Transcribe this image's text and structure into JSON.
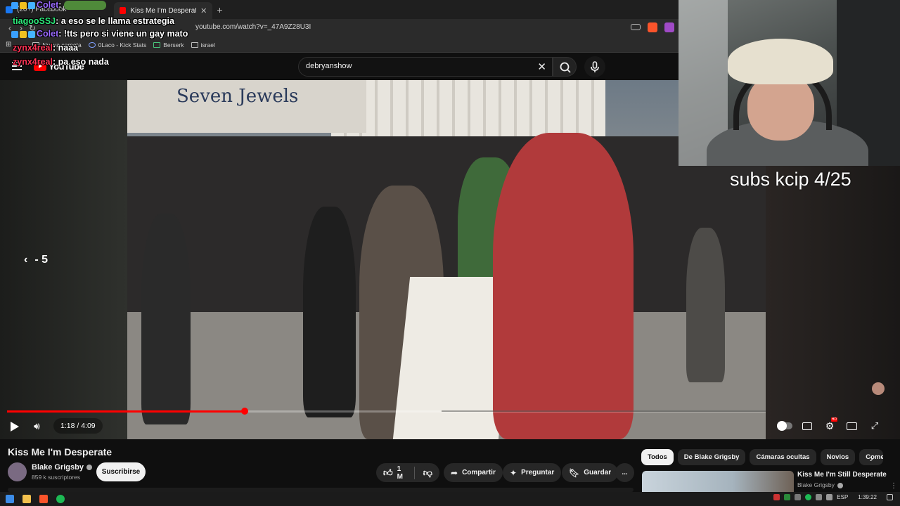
{
  "browser": {
    "tabs": [
      {
        "label": "(20+) Facebook",
        "favicon_color": "#1877f2"
      },
      {
        "label": "Kiss Me I'm Desperate - YouT",
        "favicon_color": "#ff0000"
      }
    ],
    "new_tab_label": "+",
    "url": "youtube.com/watch?v=_47A9Z28U3I",
    "bookmarks": [
      "Nueva carpeta",
      "0Laco - Kick Stats",
      "Berserk",
      "israel"
    ]
  },
  "chat": [
    {
      "user": "Colet",
      "sep": ":",
      "text": "",
      "color": "#9b6bff",
      "emote": "pepe"
    },
    {
      "user": "tiagooSSJ",
      "sep": ":",
      "text": " a eso se le llama estrategia",
      "color": "#2de87a"
    },
    {
      "user": "Colet",
      "sep": ":",
      "text": " !tts pero si viene un gay mato",
      "color": "#9b6bff"
    },
    {
      "user": "zynx4real",
      "sep": ":",
      "text": " naaa",
      "color": "#ff3355"
    },
    {
      "user": "zynx4real",
      "sep": ":",
      "text": " pa eso nada",
      "color": "#ff3355"
    }
  ],
  "youtube": {
    "logo_text": "YouTube",
    "search_value": "debryanshow",
    "player": {
      "current_time": "1:18",
      "duration": "4:09",
      "time_display": "1:18 / 4:09",
      "progress_fraction": 0.3133,
      "seek_hint": "- 5",
      "stream_overlay": "subs kcip 4/25",
      "shop_sign": "Seven Jewels"
    },
    "video": {
      "title": "Kiss Me I'm Desperate",
      "channel": "Blake Grigsby",
      "subscribers": "859 k suscriptores",
      "subscribe_label": "Suscribirse",
      "likes": "1 M",
      "share_label": "Compartir",
      "ask_label": "Preguntar",
      "save_label": "Guardar",
      "more_label": "..."
    },
    "chips": [
      "Todos",
      "De Blake Grigsby",
      "Cámaras ocultas",
      "Novios",
      "Come"
    ],
    "recommendation": {
      "title": "Kiss Me I'm Still Desperate",
      "channel": "Blake Grigsby"
    }
  },
  "taskbar": {
    "language": "ESP",
    "time": "1:39:22"
  },
  "colors": {
    "accent": "#ff0000",
    "background": "#0f0f0f"
  }
}
